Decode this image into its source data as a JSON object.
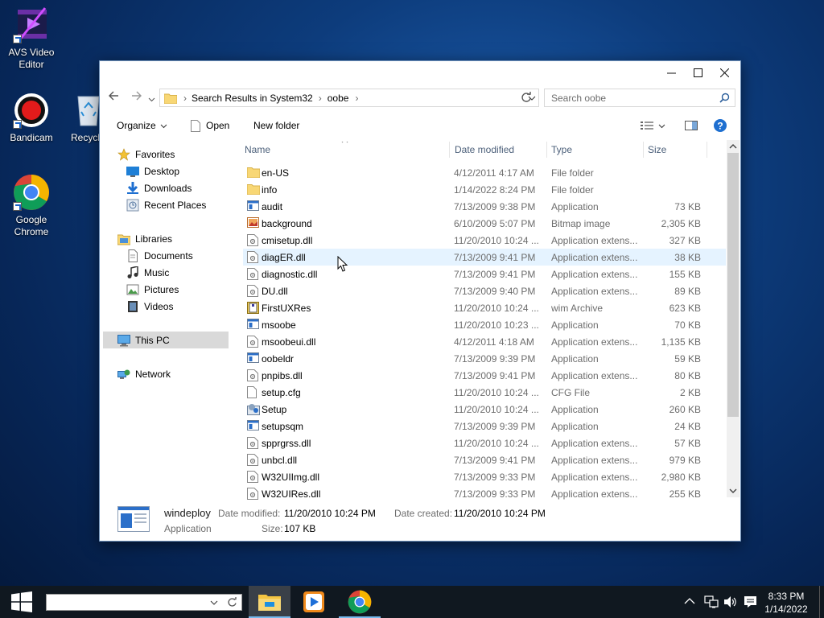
{
  "desktop": {
    "icons": [
      {
        "label": "AVS Video Editor",
        "icon": "avs-video-editor-icon"
      },
      {
        "label": "Bandicam",
        "icon": "bandicam-icon"
      },
      {
        "label": "Recycl",
        "icon": "recycle-bin-icon"
      },
      {
        "label": "Google Chrome",
        "icon": "chrome-icon"
      }
    ]
  },
  "window": {
    "controls": {
      "minimize": "—",
      "maximize": "☐",
      "close": "✕"
    },
    "address": {
      "crumbs": [
        "Search Results in System32",
        "oobe"
      ],
      "separator": "›"
    },
    "search": {
      "placeholder": "Search oobe"
    },
    "toolbar": {
      "organize": "Organize",
      "open": "Open",
      "new_folder": "New folder"
    },
    "nav": {
      "favorites": {
        "label": "Favorites",
        "items": [
          "Desktop",
          "Downloads",
          "Recent Places"
        ]
      },
      "libraries": {
        "label": "Libraries",
        "items": [
          "Documents",
          "Music",
          "Pictures",
          "Videos"
        ]
      },
      "this_pc": "This PC",
      "network": "Network"
    },
    "columns": {
      "name": "Name",
      "date": "Date modified",
      "type": "Type",
      "size": "Size"
    },
    "files": [
      {
        "name": "en-US",
        "date": "4/12/2011 4:17 AM",
        "type": "File folder",
        "size": "",
        "icon": "folder-icon"
      },
      {
        "name": "info",
        "date": "1/14/2022 8:24 PM",
        "type": "File folder",
        "size": "",
        "icon": "folder-icon"
      },
      {
        "name": "audit",
        "date": "7/13/2009 9:38 PM",
        "type": "Application",
        "size": "73 KB",
        "icon": "application-icon"
      },
      {
        "name": "background",
        "date": "6/10/2009 5:07 PM",
        "type": "Bitmap image",
        "size": "2,305 KB",
        "icon": "bitmap-icon"
      },
      {
        "name": "cmisetup.dll",
        "date": "11/20/2010 10:24 ...",
        "type": "Application extens...",
        "size": "327 KB",
        "icon": "dll-icon"
      },
      {
        "name": "diagER.dll",
        "date": "7/13/2009 9:41 PM",
        "type": "Application extens...",
        "size": "38 KB",
        "icon": "dll-icon"
      },
      {
        "name": "diagnostic.dll",
        "date": "7/13/2009 9:41 PM",
        "type": "Application extens...",
        "size": "155 KB",
        "icon": "dll-icon"
      },
      {
        "name": "DU.dll",
        "date": "7/13/2009 9:40 PM",
        "type": "Application extens...",
        "size": "89 KB",
        "icon": "dll-icon"
      },
      {
        "name": "FirstUXRes",
        "date": "11/20/2010 10:24 ...",
        "type": "wim Archive",
        "size": "623 KB",
        "icon": "archive-icon"
      },
      {
        "name": "msoobe",
        "date": "11/20/2010 10:23 ...",
        "type": "Application",
        "size": "70 KB",
        "icon": "application-icon"
      },
      {
        "name": "msoobeui.dll",
        "date": "4/12/2011 4:18 AM",
        "type": "Application extens...",
        "size": "1,135 KB",
        "icon": "dll-icon"
      },
      {
        "name": "oobeldr",
        "date": "7/13/2009 9:39 PM",
        "type": "Application",
        "size": "59 KB",
        "icon": "application-icon"
      },
      {
        "name": "pnpibs.dll",
        "date": "7/13/2009 9:41 PM",
        "type": "Application extens...",
        "size": "80 KB",
        "icon": "dll-icon"
      },
      {
        "name": "setup.cfg",
        "date": "11/20/2010 10:24 ...",
        "type": "CFG File",
        "size": "2 KB",
        "icon": "file-icon"
      },
      {
        "name": "Setup",
        "date": "11/20/2010 10:24 ...",
        "type": "Application",
        "size": "260 KB",
        "icon": "setup-icon"
      },
      {
        "name": "setupsqm",
        "date": "7/13/2009 9:39 PM",
        "type": "Application",
        "size": "24 KB",
        "icon": "application-icon"
      },
      {
        "name": "spprgrss.dll",
        "date": "11/20/2010 10:24 ...",
        "type": "Application extens...",
        "size": "57 KB",
        "icon": "dll-icon"
      },
      {
        "name": "unbcl.dll",
        "date": "7/13/2009 9:41 PM",
        "type": "Application extens...",
        "size": "979 KB",
        "icon": "dll-icon"
      },
      {
        "name": "W32UIImg.dll",
        "date": "7/13/2009 9:33 PM",
        "type": "Application extens...",
        "size": "2,980 KB",
        "icon": "dll-icon"
      },
      {
        "name": "W32UIRes.dll",
        "date": "7/13/2009 9:33 PM",
        "type": "Application extens...",
        "size": "255 KB",
        "icon": "dll-icon"
      }
    ],
    "hovered_index": 5,
    "details": {
      "name": "windeploy",
      "type": "Application",
      "modified_label": "Date modified:",
      "modified_value": "11/20/2010 10:24 PM",
      "created_label": "Date created:",
      "created_value": "11/20/2010 10:24 PM",
      "size_label": "Size:",
      "size_value": "107 KB"
    }
  },
  "taskbar": {
    "apps": [
      "file-explorer-icon",
      "media-player-icon",
      "chrome-icon"
    ],
    "clock": {
      "time": "8:33 PM",
      "date": "1/14/2022"
    }
  },
  "colors": {
    "accent": "#0078d7",
    "selection": "#cce8ff",
    "hover": "#e5f3ff",
    "folder": "#f8d775"
  }
}
